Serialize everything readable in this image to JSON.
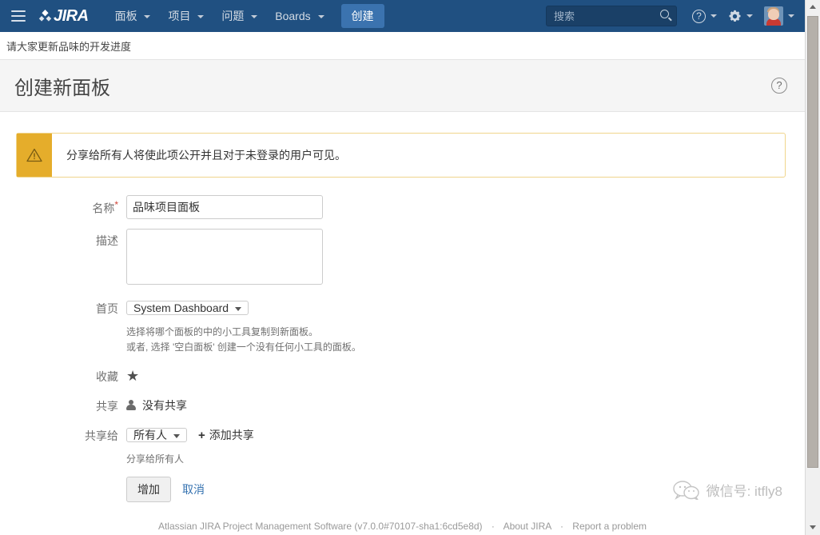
{
  "topnav": {
    "menu_icon": "hamburger-icon",
    "logo_text": "JIRA",
    "items": [
      {
        "label": "面板"
      },
      {
        "label": "项目"
      },
      {
        "label": "问题"
      },
      {
        "label": "Boards"
      }
    ],
    "create_label": "创建",
    "search": {
      "placeholder": "搜索",
      "value": ""
    },
    "help_label": "?",
    "icons": [
      "search-icon",
      "help-icon",
      "gear-icon",
      "avatar"
    ]
  },
  "breadcrumb": {
    "text": "请大家更新品味的开发进度"
  },
  "page": {
    "title": "创建新面板",
    "help_label": "?"
  },
  "warning": {
    "icon": "warning-triangle-icon",
    "message": "分享给所有人将使此项公开并且对于未登录的用户可见。"
  },
  "form": {
    "name": {
      "label": "名称",
      "required_mark": "*",
      "value": "品味项目面板"
    },
    "description": {
      "label": "描述",
      "value": ""
    },
    "homepage": {
      "label": "首页",
      "selected": "System Dashboard",
      "help_line1": "选择将哪个面板的中的小工具复制到新面板。",
      "help_line2": "或者, 选择 '空白面板' 创建一个没有任何小工具的面板。"
    },
    "favorite": {
      "label": "收藏",
      "star": "★"
    },
    "share": {
      "label": "共享",
      "value": "没有共享"
    },
    "share_with": {
      "label": "共享给",
      "selected": "所有人",
      "add_label": "添加共享",
      "add_icon": "+",
      "help": "分享给所有人"
    },
    "actions": {
      "submit_label": "增加",
      "cancel_label": "取消"
    }
  },
  "footer": {
    "product": "Atlassian JIRA Project Management Software (v7.0.0#70107-sha1:6cd5e8d)",
    "about_label": "About JIRA",
    "report_label": "Report a problem",
    "separator": "·"
  },
  "watermark": {
    "text": "微信号: itfly8"
  },
  "colors": {
    "header_blue": "#205081",
    "create_button_blue": "#3b73af",
    "warning_amber": "#e5ad2b",
    "link_blue": "#3572b0",
    "required_red": "#d04437"
  }
}
